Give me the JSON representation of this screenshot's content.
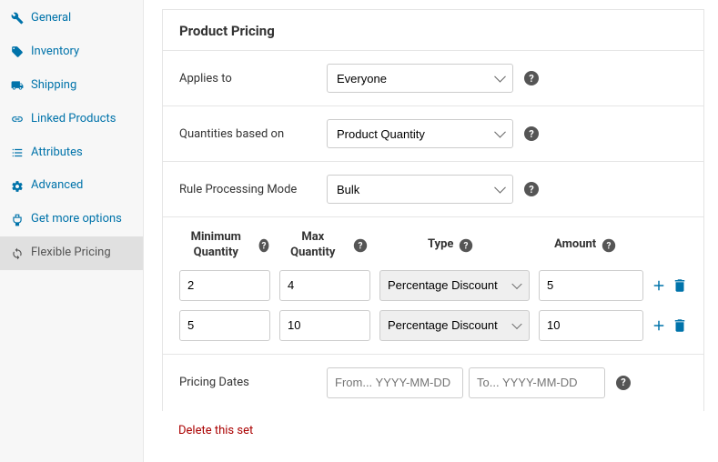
{
  "sidebar": {
    "items": [
      {
        "label": "General",
        "icon": "wrench"
      },
      {
        "label": "Inventory",
        "icon": "tag"
      },
      {
        "label": "Shipping",
        "icon": "truck"
      },
      {
        "label": "Linked Products",
        "icon": "link"
      },
      {
        "label": "Attributes",
        "icon": "list"
      },
      {
        "label": "Advanced",
        "icon": "gear"
      },
      {
        "label": "Get more options",
        "icon": "plugin"
      },
      {
        "label": "Flexible Pricing",
        "icon": "refresh",
        "active": true
      }
    ]
  },
  "main": {
    "title": "Product Pricing",
    "applies_to": {
      "label": "Applies to",
      "value": "Everyone"
    },
    "quantities_based": {
      "label": "Quantities based on",
      "value": "Product Quantity"
    },
    "processing_mode": {
      "label": "Rule Processing Mode",
      "value": "Bulk"
    },
    "rules": {
      "headers": {
        "min": "Minimum Quantity",
        "max": "Max Quantity",
        "type": "Type",
        "amount": "Amount"
      },
      "rows": [
        {
          "min": "2",
          "max": "4",
          "type": "Percentage Discount",
          "amount": "5"
        },
        {
          "min": "5",
          "max": "10",
          "type": "Percentage Discount",
          "amount": "10"
        }
      ]
    },
    "dates": {
      "label": "Pricing Dates",
      "from_placeholder": "From... YYYY-MM-DD",
      "to_placeholder": "To... YYYY-MM-DD"
    },
    "delete_label": "Delete this set",
    "help_char": "?"
  }
}
